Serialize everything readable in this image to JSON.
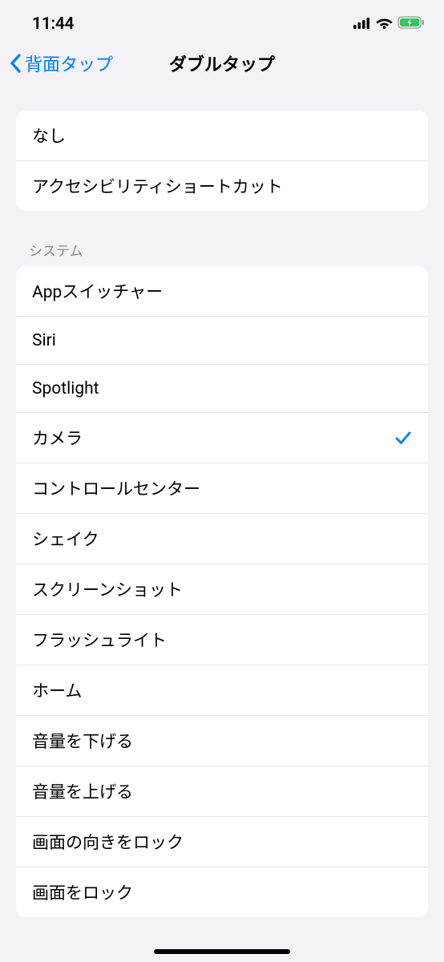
{
  "status": {
    "time": "11:44"
  },
  "nav": {
    "back_label": "背面タップ",
    "title": "ダブルタップ"
  },
  "groups": [
    {
      "header": "",
      "items": [
        {
          "label": "なし",
          "selected": false
        },
        {
          "label": "アクセシビリティショートカット",
          "selected": false
        }
      ]
    },
    {
      "header": "システム",
      "items": [
        {
          "label": "Appスイッチャー",
          "selected": false
        },
        {
          "label": "Siri",
          "selected": false
        },
        {
          "label": "Spotlight",
          "selected": false
        },
        {
          "label": "カメラ",
          "selected": true
        },
        {
          "label": "コントロールセンター",
          "selected": false
        },
        {
          "label": "シェイク",
          "selected": false
        },
        {
          "label": "スクリーンショット",
          "selected": false
        },
        {
          "label": "フラッシュライト",
          "selected": false
        },
        {
          "label": "ホーム",
          "selected": false
        },
        {
          "label": "音量を下げる",
          "selected": false
        },
        {
          "label": "音量を上げる",
          "selected": false
        },
        {
          "label": "画面の向きをロック",
          "selected": false
        },
        {
          "label": "画面をロック",
          "selected": false
        }
      ]
    }
  ]
}
